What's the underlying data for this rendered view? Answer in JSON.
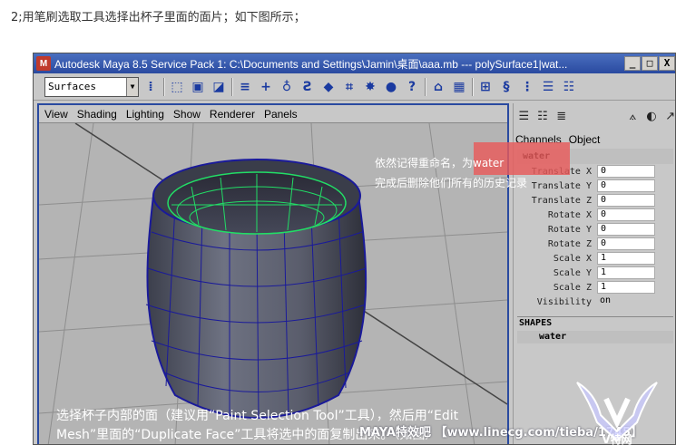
{
  "page": {
    "caption": "2;用笔刷选取工具选择出杯子里面的面片；如下图所示；"
  },
  "window": {
    "title": "Autodesk Maya 8.5 Service Pack 1: C:\\Documents and Settings\\Jamin\\桌面\\aaa.mb   ---   polySurface1|wat...",
    "buttons": {
      "minimize": "_",
      "maximize": "□",
      "close": "X"
    }
  },
  "toolbar": {
    "menu_set": "Surfaces",
    "icons": [
      "select-icon",
      "lasso-icon",
      "paint-select-icon",
      "snap-icon",
      "plus-icon",
      "curve-icon",
      "rotate-icon",
      "cube-icon",
      "mesh-icon",
      "light-icon",
      "help-icon",
      "lock-icon",
      "render-icon",
      "grid-icon",
      "history-icon",
      "selection-icon",
      "outliner-icon",
      "attribute-icon"
    ]
  },
  "viewport": {
    "menu": [
      "View",
      "Shading",
      "Lighting",
      "Show",
      "Renderer",
      "Panels"
    ]
  },
  "channel_box": {
    "menu": [
      "Channels",
      "Object"
    ],
    "object_name": "water",
    "attributes": [
      {
        "label": "Translate X",
        "value": "0"
      },
      {
        "label": "Translate Y",
        "value": "0"
      },
      {
        "label": "Translate Z",
        "value": "0"
      },
      {
        "label": "Rotate X",
        "value": "0"
      },
      {
        "label": "Rotate Y",
        "value": "0"
      },
      {
        "label": "Rotate Z",
        "value": "0"
      },
      {
        "label": "Scale X",
        "value": "1"
      },
      {
        "label": "Scale Y",
        "value": "1"
      },
      {
        "label": "Scale Z",
        "value": "1"
      },
      {
        "label": "Visibility",
        "value": "on"
      }
    ],
    "shapes_header": "SHAPES",
    "shape_name": "water"
  },
  "annotations": {
    "rename": "依然记得重命名，为water",
    "history": "完成后删除他们所有的历史记录",
    "bottom_line1": "选择杯子内部的面（建议用“Paint Selection Tool”工具），然后用“Edit",
    "bottom_line2": "Mesh”里面的“Duplicate Face”工具将选中的面复制出来。（如图）"
  },
  "watermark": {
    "text": "MAYA特效吧 【www.linecg.com/tieba/1745】",
    "logo_text": "V特网"
  },
  "colors": {
    "title_bar": "#2a4aa0",
    "mesh_wire": "#1a1a9a",
    "selected_wire": "#22dd66",
    "highlight": "#e85a5a"
  }
}
